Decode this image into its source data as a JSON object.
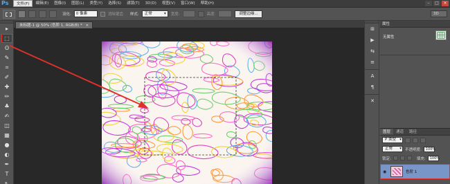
{
  "app": {
    "logo": "Ps"
  },
  "menu": [
    "文件(F)",
    "编辑(E)",
    "图像(I)",
    "图层(L)",
    "类型(Y)",
    "选择(S)",
    "滤镜(T)",
    "3D(D)",
    "视图(V)",
    "窗口(W)",
    "帮助(H)"
  ],
  "window_controls": {
    "minimize": "–",
    "maximize": "□",
    "close": "×"
  },
  "options": {
    "feather_label": "羽化:",
    "feather_value": "0 像素",
    "antialias_label": "消除锯齿",
    "style_label": "样式:",
    "style_value": "正常",
    "width_label": "宽度:",
    "height_label": "高度:",
    "refine_button": "调整边缘...",
    "workspace": "3D"
  },
  "document": {
    "tab_title": "未标题-1 @ 50% (色阶 1, RGB/8) *",
    "tab_close": "×"
  },
  "tools": [
    "move-tool",
    "marquee-tool",
    "lasso-tool",
    "quick-select-tool",
    "crop-tool",
    "eyedropper-tool",
    "healing-tool",
    "brush-tool",
    "clone-stamp-tool",
    "history-brush-tool",
    "eraser-tool",
    "gradient-tool",
    "blur-tool",
    "dodge-tool",
    "pen-tool",
    "type-tool",
    "path-select-tool"
  ],
  "tool_glyphs": [
    "▸",
    "⬚",
    "ʘ",
    "✎",
    "⌗",
    "✐",
    "✚",
    "✏",
    "♣",
    "✍",
    "◫",
    "▦",
    "●",
    "◐",
    "✒",
    "T",
    "↖"
  ],
  "right_icons": {
    "group1": [
      "⊞",
      "▶",
      "⇆",
      "≡"
    ],
    "group2": [
      "A",
      "¶"
    ],
    "group3": [
      "✕"
    ]
  },
  "properties": {
    "title": "属性",
    "label": "无属性"
  },
  "layers": {
    "tabs": [
      "图层",
      "通道",
      "路径"
    ],
    "filter_value": "P 类型",
    "blend_mode": "正常",
    "opacity_label": "不透明度:",
    "opacity_value": "100%",
    "lock_label": "锁定:",
    "fill_label": "填充:",
    "fill_value": "100%",
    "layer_name": "色阶 1",
    "eye": "◉"
  },
  "colors": {
    "annotation": "#e0302a",
    "layer_selected": "#7896c8"
  }
}
